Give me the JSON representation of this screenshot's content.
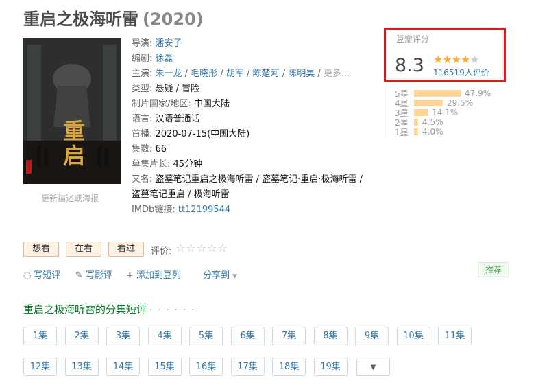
{
  "title": {
    "name": "重启之极海听雷",
    "year": "(2020)"
  },
  "poster": {
    "alt_big_text": "重启",
    "update_link": "更新描述或海报"
  },
  "info": {
    "director_label": "导演:",
    "director": "潘安子",
    "writer_label": "编剧:",
    "writer": "徐磊",
    "cast_label": "主演:",
    "cast": [
      "朱一龙",
      "毛晓彤",
      "胡军",
      "陈楚河",
      "陈明昊"
    ],
    "cast_more": "更多...",
    "genre_label": "类型:",
    "genre": "悬疑 / 冒险",
    "country_label": "制片国家/地区:",
    "country": "中国大陆",
    "language_label": "语言:",
    "language": "汉语普通话",
    "premiere_label": "首播:",
    "premiere": "2020-07-15(中国大陆)",
    "episodes_label": "集数:",
    "episodes": "66",
    "runtime_label": "单集片长:",
    "runtime": "45分钟",
    "aka_label": "又名:",
    "aka_line1": "盗墓笔记重启之极海听雷 / 盗墓笔记·重启·极海听雷 /",
    "aka_line2": "盗墓笔记重启 / 极海听雷",
    "imdb_label": "IMDb链接:",
    "imdb": "tt12199544"
  },
  "rating": {
    "header": "豆瓣评分",
    "score": "8.3",
    "stars_filled": 4,
    "votes": "116519人评价",
    "distribution": [
      {
        "label": "5星",
        "percent": "47.9%",
        "value": 47.9
      },
      {
        "label": "4星",
        "percent": "29.5%",
        "value": 29.5
      },
      {
        "label": "3星",
        "percent": "14.1%",
        "value": 14.1
      },
      {
        "label": "2星",
        "percent": "4.5%",
        "value": 4.5
      },
      {
        "label": "1星",
        "percent": "4.0%",
        "value": 4.0
      }
    ]
  },
  "interest": {
    "want": "想看",
    "watching": "在看",
    "watched": "看过",
    "rate_label": "评价:",
    "rate_stars": "☆☆☆☆☆"
  },
  "actions": {
    "short_review": "写短评",
    "review": "写影评",
    "add_doulist": "添加到豆列",
    "share": "分享到"
  },
  "recommend": "推荐",
  "episodes_section": {
    "title": "重启之极海听雷的分集短评",
    "dots": "· · · · · ·",
    "row1": [
      "1集",
      "2集",
      "3集",
      "4集",
      "5集",
      "6集",
      "7集",
      "8集",
      "9集",
      "10集",
      "11集"
    ],
    "row2": [
      "12集",
      "13集",
      "14集",
      "15集",
      "16集",
      "17集",
      "18集",
      "19集"
    ]
  }
}
